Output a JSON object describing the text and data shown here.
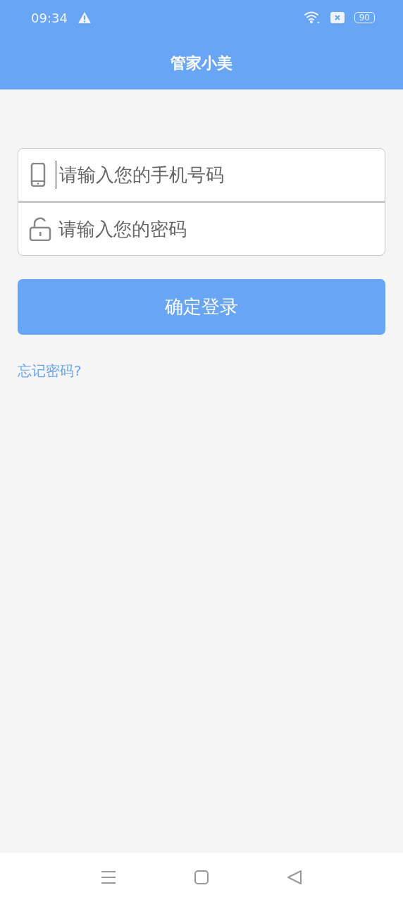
{
  "status_bar": {
    "time": "09:34",
    "battery": "90"
  },
  "header": {
    "title": "管家小美"
  },
  "fields": [
    {
      "kind": "phone",
      "placeholder": "请输入您的手机号码",
      "focused": true
    },
    {
      "kind": "password",
      "placeholder": "请输入您的密码",
      "focused": false
    }
  ],
  "submit_button": "确定登录",
  "forgot_link": "忘记密码?"
}
